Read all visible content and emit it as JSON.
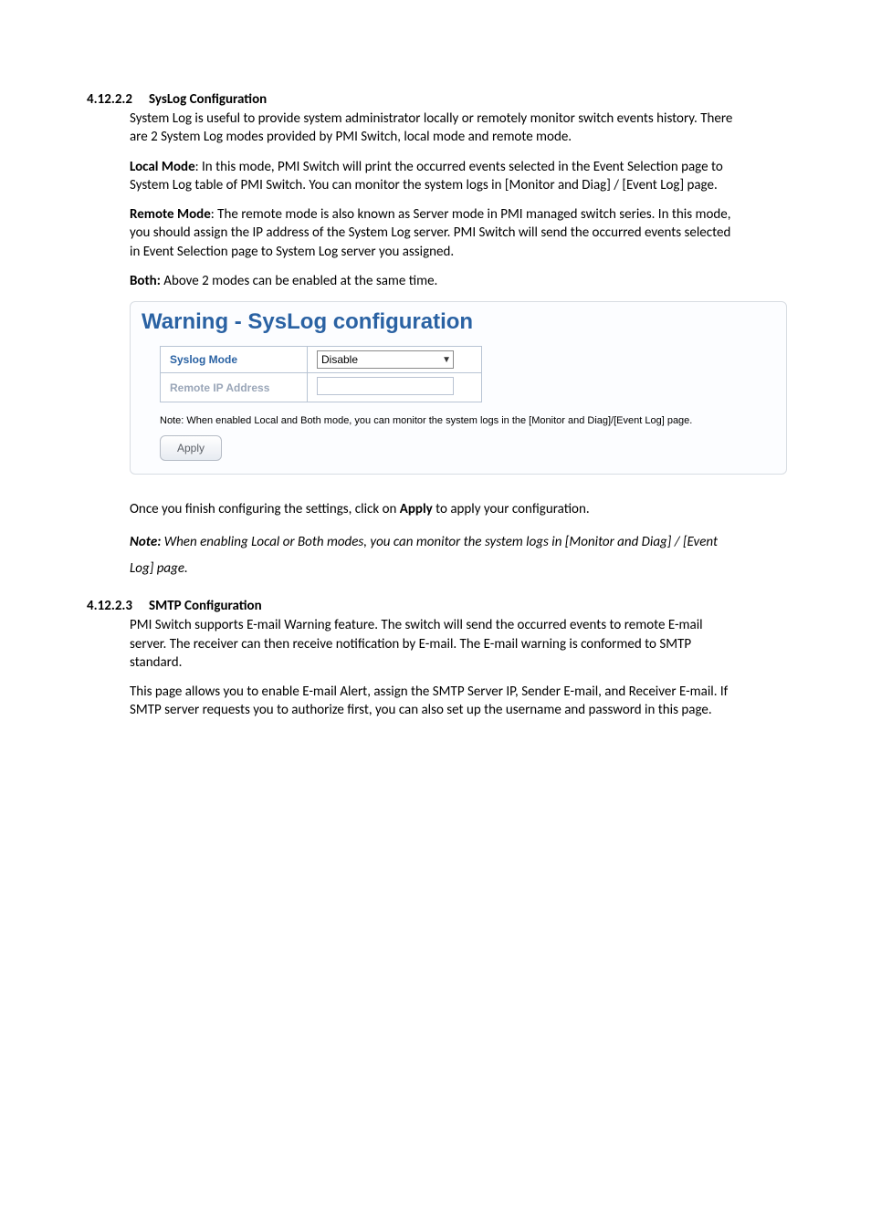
{
  "section1": {
    "number": "4.12.2.2",
    "title": "SysLog Configuration",
    "para1": "System Log is useful to provide system administrator locally or remotely monitor switch events history. There are 2 System Log modes provided by PMI Switch, local mode and remote mode.",
    "para2_label": "Local Mode",
    "para2_text": ": In this mode, PMI Switch will print the occurred events selected in the Event Selection page to System Log table of PMI Switch. You can monitor the system logs in [Monitor and Diag] / [Event Log] page.",
    "para3_label": "Remote Mode",
    "para3_text": ": The remote mode is also known as Server mode in PMI managed switch series. In this mode, you should assign the IP address of the System Log server. PMI Switch will send the occurred events selected in Event Selection page to System Log server you assigned.",
    "para4_label": "Both:",
    "para4_text": " Above 2 modes can be enabled at the same time."
  },
  "panel": {
    "title": "Warning - SysLog configuration",
    "row1_label": "Syslog Mode",
    "row1_value": "Disable",
    "row2_label": "Remote IP Address",
    "note": "Note: When enabled Local and Both mode, you can monitor the system logs in the [Monitor and Diag]/[Event Log] page.",
    "apply": "Apply"
  },
  "after_panel": {
    "para1a": "Once you finish configuring the settings, click on ",
    "para1b": "Apply",
    "para1c": " to apply your configuration.",
    "note_label": "Note:",
    "note_text": " When enabling Local or Both modes, you can monitor the system logs in [Monitor and Diag] / [Event Log] page."
  },
  "section2": {
    "number": "4.12.2.3",
    "title": "SMTP Configuration",
    "para1": "PMI Switch supports E-mail Warning feature. The switch will send the occurred events to remote E-mail server. The receiver can then receive notification by E-mail. The E-mail warning is conformed to SMTP standard.",
    "para2": "This page allows you to enable E-mail Alert, assign the SMTP Server IP, Sender E-mail, and Receiver E-mail. If SMTP server requests you to authorize first, you can also set up the username and password in this page."
  }
}
